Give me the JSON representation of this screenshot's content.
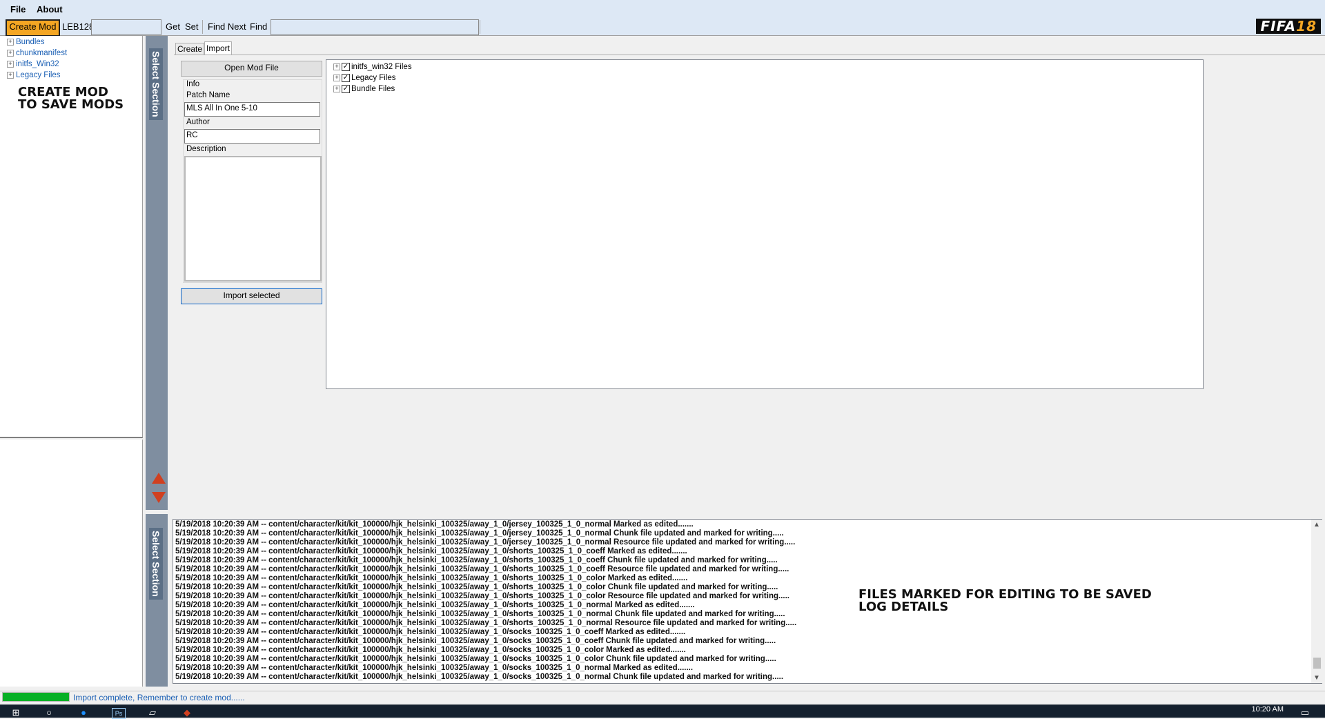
{
  "menu": {
    "items": [
      "File",
      "About"
    ]
  },
  "toolbar": {
    "create_mod": "Create Mod",
    "cipher_label": "LEB128",
    "cipher_value": "",
    "get": "Get",
    "set": "Set",
    "find_next": "Find Next",
    "find": "Find",
    "find_value": ""
  },
  "brand": {
    "logo_text": "FIFA",
    "logo_number": "18"
  },
  "tree": {
    "items": [
      "Bundles",
      "chunkmanifest",
      "initfs_Win32",
      "Legacy Files"
    ],
    "overlay_note_line1": "CREATE MOD",
    "overlay_note_line2": "TO SAVE MODS"
  },
  "section": {
    "label": "Select Section"
  },
  "tabs": [
    "Create",
    "Import"
  ],
  "import_form": {
    "open_button": "Open Mod File",
    "info_heading": "Info",
    "patch_name_label": "Patch Name",
    "patch_name_value": "MLS All In One 5-10",
    "author_label": "Author",
    "author_value": "RC",
    "description_label": "Description",
    "description_value": "",
    "import_button": "Import selected"
  },
  "import_files": [
    {
      "label": "initfs_win32 Files",
      "checked": true
    },
    {
      "label": "Legacy Files",
      "checked": true
    },
    {
      "label": "Bundle Files",
      "checked": true
    }
  ],
  "log": {
    "lines": [
      "5/19/2018 10:20:39 AM -- content/character/kit/kit_100000/hjk_helsinki_100325/away_1_0/jersey_100325_1_0_normal Marked as edited.......",
      "5/19/2018 10:20:39 AM -- content/character/kit/kit_100000/hjk_helsinki_100325/away_1_0/jersey_100325_1_0_normal Chunk file updated and marked for writing.....",
      "5/19/2018 10:20:39 AM -- content/character/kit/kit_100000/hjk_helsinki_100325/away_1_0/jersey_100325_1_0_normal Resource file updated and marked for writing.....",
      "5/19/2018 10:20:39 AM -- content/character/kit/kit_100000/hjk_helsinki_100325/away_1_0/shorts_100325_1_0_coeff Marked as edited.......",
      "5/19/2018 10:20:39 AM -- content/character/kit/kit_100000/hjk_helsinki_100325/away_1_0/shorts_100325_1_0_coeff Chunk file updated and marked for writing.....",
      "5/19/2018 10:20:39 AM -- content/character/kit/kit_100000/hjk_helsinki_100325/away_1_0/shorts_100325_1_0_coeff Resource file updated and marked for writing.....",
      "5/19/2018 10:20:39 AM -- content/character/kit/kit_100000/hjk_helsinki_100325/away_1_0/shorts_100325_1_0_color Marked as edited.......",
      "5/19/2018 10:20:39 AM -- content/character/kit/kit_100000/hjk_helsinki_100325/away_1_0/shorts_100325_1_0_color Chunk file updated and marked for writing.....",
      "5/19/2018 10:20:39 AM -- content/character/kit/kit_100000/hjk_helsinki_100325/away_1_0/shorts_100325_1_0_color Resource file updated and marked for writing.....",
      "5/19/2018 10:20:39 AM -- content/character/kit/kit_100000/hjk_helsinki_100325/away_1_0/shorts_100325_1_0_normal Marked as edited.......",
      "5/19/2018 10:20:39 AM -- content/character/kit/kit_100000/hjk_helsinki_100325/away_1_0/shorts_100325_1_0_normal Chunk file updated and marked for writing.....",
      "5/19/2018 10:20:39 AM -- content/character/kit/kit_100000/hjk_helsinki_100325/away_1_0/shorts_100325_1_0_normal Resource file updated and marked for writing.....",
      "5/19/2018 10:20:39 AM -- content/character/kit/kit_100000/hjk_helsinki_100325/away_1_0/socks_100325_1_0_coeff Marked as edited.......",
      "5/19/2018 10:20:39 AM -- content/character/kit/kit_100000/hjk_helsinki_100325/away_1_0/socks_100325_1_0_coeff Chunk file updated and marked for writing.....",
      "5/19/2018 10:20:39 AM -- content/character/kit/kit_100000/hjk_helsinki_100325/away_1_0/socks_100325_1_0_color Marked as edited.......",
      "5/19/2018 10:20:39 AM -- content/character/kit/kit_100000/hjk_helsinki_100325/away_1_0/socks_100325_1_0_color Chunk file updated and marked for writing.....",
      "5/19/2018 10:20:39 AM -- content/character/kit/kit_100000/hjk_helsinki_100325/away_1_0/socks_100325_1_0_normal Marked as edited.......",
      "5/19/2018 10:20:39 AM -- content/character/kit/kit_100000/hjk_helsinki_100325/away_1_0/socks_100325_1_0_normal Chunk file updated and marked for writing....."
    ],
    "overlay_note_line1": "FILES MARKED FOR EDITING TO BE SAVED",
    "overlay_note_line2": "LOG DETAILS"
  },
  "status": {
    "text": "Import complete, Remember to create mod......",
    "progress": 1.0
  },
  "taskbar": {
    "clock": "10:20 AM"
  },
  "colors": {
    "accent": "#f4a623",
    "section_bar": "#7f8ea0",
    "progress": "#06b025",
    "link": "#1a5fb4"
  }
}
